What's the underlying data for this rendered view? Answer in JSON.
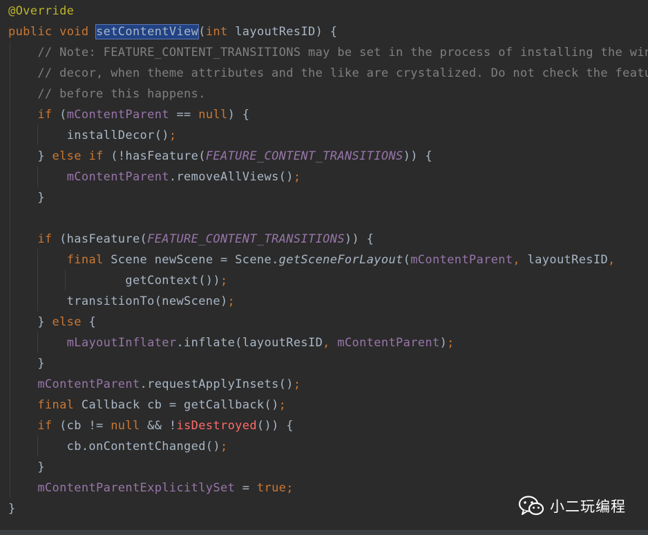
{
  "code_lines": [
    [
      [
        "tk-ann",
        "@Override"
      ]
    ],
    [
      [
        "tk-kw",
        "public"
      ],
      [
        "",
        " "
      ],
      [
        "tk-kw",
        "void"
      ],
      [
        "",
        " "
      ],
      [
        "tk-sel",
        "setContentView"
      ],
      [
        "",
        "("
      ],
      [
        "tk-kw",
        "int"
      ],
      [
        "",
        " layoutResID) {"
      ]
    ],
    [
      [
        "",
        "    "
      ],
      [
        "tk-cmt",
        "// Note: FEATURE_CONTENT_TRANSITIONS may be set in the process of installing the window"
      ]
    ],
    [
      [
        "",
        "    "
      ],
      [
        "tk-cmt",
        "// decor, when theme attributes and the like are crystalized. Do not check the feature"
      ]
    ],
    [
      [
        "",
        "    "
      ],
      [
        "tk-cmt",
        "// before this happens."
      ]
    ],
    [
      [
        "",
        "    "
      ],
      [
        "tk-kw",
        "if"
      ],
      [
        "",
        " ("
      ],
      [
        "tk-field",
        "mContentParent"
      ],
      [
        "",
        " == "
      ],
      [
        "tk-kw",
        "null"
      ],
      [
        "",
        ") {"
      ]
    ],
    [
      [
        "",
        "        installDecor()"
      ],
      [
        "tk-punct",
        ";"
      ]
    ],
    [
      [
        "",
        "    } "
      ],
      [
        "tk-kw",
        "else if"
      ],
      [
        "",
        " (!hasFeature("
      ],
      [
        "tk-const",
        "FEATURE_CONTENT_TRANSITIONS"
      ],
      [
        "",
        ")) {"
      ]
    ],
    [
      [
        "",
        "        "
      ],
      [
        "tk-field",
        "mContentParent"
      ],
      [
        "",
        ".removeAllViews()"
      ],
      [
        "tk-punct",
        ";"
      ]
    ],
    [
      [
        "",
        "    }"
      ]
    ],
    [
      [
        "",
        ""
      ]
    ],
    [
      [
        "",
        "    "
      ],
      [
        "tk-kw",
        "if"
      ],
      [
        "",
        " (hasFeature("
      ],
      [
        "tk-const",
        "FEATURE_CONTENT_TRANSITIONS"
      ],
      [
        "",
        ")) {"
      ]
    ],
    [
      [
        "",
        "        "
      ],
      [
        "tk-kw",
        "final"
      ],
      [
        "",
        " Scene newScene = Scene."
      ],
      [
        "tk-static",
        "getSceneForLayout"
      ],
      [
        "",
        "("
      ],
      [
        "tk-field",
        "mContentParent"
      ],
      [
        "tk-punct",
        ","
      ],
      [
        "",
        " layoutResID"
      ],
      [
        "tk-punct",
        ","
      ]
    ],
    [
      [
        "",
        "                getContext())"
      ],
      [
        "tk-punct",
        ";"
      ]
    ],
    [
      [
        "",
        "        transitionTo(newScene)"
      ],
      [
        "tk-punct",
        ";"
      ]
    ],
    [
      [
        "",
        "    } "
      ],
      [
        "tk-kw",
        "else"
      ],
      [
        "",
        " {"
      ]
    ],
    [
      [
        "",
        "        "
      ],
      [
        "tk-field",
        "mLayoutInflater"
      ],
      [
        "",
        ".inflate(layoutResID"
      ],
      [
        "tk-punct",
        ","
      ],
      [
        "",
        " "
      ],
      [
        "tk-field",
        "mContentParent"
      ],
      [
        "",
        ")"
      ],
      [
        "tk-punct",
        ";"
      ]
    ],
    [
      [
        "",
        "    }"
      ]
    ],
    [
      [
        "",
        "    "
      ],
      [
        "tk-field",
        "mContentParent"
      ],
      [
        "",
        ".requestApplyInsets()"
      ],
      [
        "tk-punct",
        ";"
      ]
    ],
    [
      [
        "",
        "    "
      ],
      [
        "tk-kw",
        "final"
      ],
      [
        "",
        " Callback cb = getCallback()"
      ],
      [
        "tk-punct",
        ";"
      ]
    ],
    [
      [
        "",
        "    "
      ],
      [
        "tk-kw",
        "if"
      ],
      [
        "",
        " (cb != "
      ],
      [
        "tk-kw",
        "null"
      ],
      [
        "",
        " && !"
      ],
      [
        "tk-err",
        "isDestroyed"
      ],
      [
        "",
        "()) {"
      ]
    ],
    [
      [
        "",
        "        cb.onContentChanged()"
      ],
      [
        "tk-punct",
        ";"
      ]
    ],
    [
      [
        "",
        "    }"
      ]
    ],
    [
      [
        "",
        "    "
      ],
      [
        "tk-field",
        "mContentParentExplicitlySet"
      ],
      [
        "",
        " = "
      ],
      [
        "tk-kw",
        "true"
      ],
      [
        "tk-punct",
        ";"
      ]
    ],
    [
      [
        "",
        "}"
      ]
    ]
  ],
  "watermark": {
    "icon": "wechat-icon",
    "text": "小二玩编程",
    "color": "#ffffff"
  },
  "colors": {
    "background": "#2b2b2b",
    "keyword": "#cc7832",
    "field": "#9876aa",
    "comment": "#808080",
    "annotation": "#bbb529",
    "selection": "#214283"
  }
}
